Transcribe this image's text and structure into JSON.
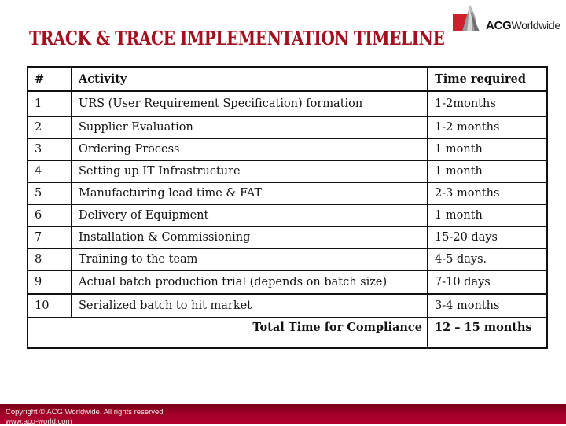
{
  "header": {
    "title": "TRACK & TRACE IMPLEMENTATION TIMELINE",
    "logo": {
      "brand": "ACG",
      "suffix": "Worldwide",
      "icon": "acg-logo-icon",
      "accent": "#d0202e"
    }
  },
  "table": {
    "columns": [
      "#",
      "Activity",
      "Time required"
    ],
    "rows": [
      {
        "num": "1",
        "activity": "URS (User Requirement Specification) formation",
        "time": "1-2months"
      },
      {
        "num": "2",
        "activity": "Supplier Evaluation",
        "time": "1-2 months"
      },
      {
        "num": "3",
        "activity": "Ordering Process",
        "time": "1 month"
      },
      {
        "num": "4",
        "activity": "Setting up IT Infrastructure",
        "time": "1 month"
      },
      {
        "num": "5",
        "activity": "Manufacturing lead time & FAT",
        "time": "2-3 months"
      },
      {
        "num": "6",
        "activity": "Delivery of Equipment",
        "time": "1 month"
      },
      {
        "num": "7",
        "activity": "Installation & Commissioning",
        "time": "15-20 days"
      },
      {
        "num": "8",
        "activity": "Training to the team",
        "time": "4-5 days."
      },
      {
        "num": "9",
        "activity": "Actual batch production trial (depends on batch size)",
        "time": "7-10 days"
      },
      {
        "num": "10",
        "activity": "Serialized batch to hit market",
        "time": "3-4 months"
      }
    ],
    "total": {
      "label": "Total Time for Compliance",
      "value": "12 – 15 months"
    }
  },
  "footer": {
    "copyright": "Copyright © ACG Worldwide. All rights reserved",
    "url": "www.acg-world.com",
    "color": "#a6002a"
  },
  "colors": {
    "title": "#a3101f"
  }
}
